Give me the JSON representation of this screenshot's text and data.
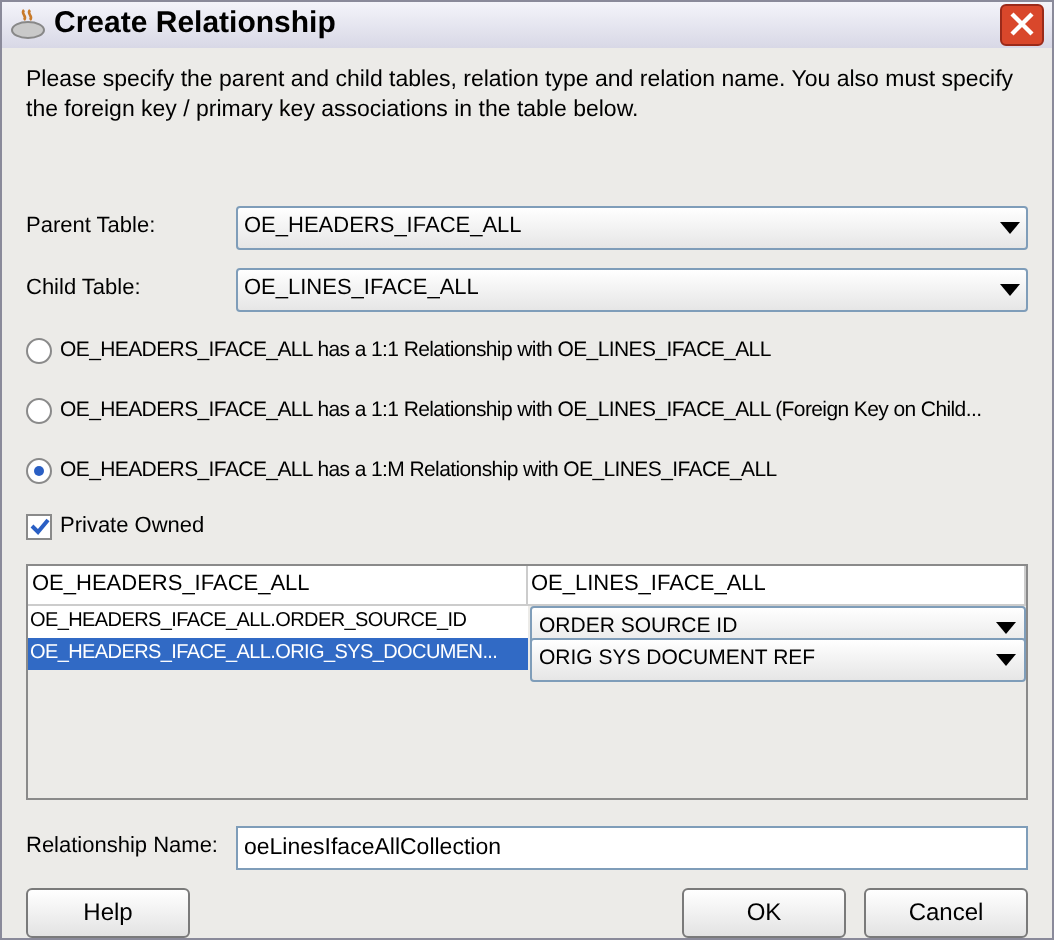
{
  "window": {
    "title": "Create Relationship"
  },
  "instructions": "Please specify the parent and child tables, relation type and relation name.  You also must specify the foreign key / primary key associations in the table below.",
  "parent_table": {
    "label": "Parent Table:",
    "value": "OE_HEADERS_IFACE_ALL"
  },
  "child_table": {
    "label": "Child Table:",
    "value": "OE_LINES_IFACE_ALL"
  },
  "relationship_types": [
    {
      "label": "OE_HEADERS_IFACE_ALL has a 1:1 Relationship with OE_LINES_IFACE_ALL",
      "selected": false
    },
    {
      "label": "OE_HEADERS_IFACE_ALL has a 1:1 Relationship with OE_LINES_IFACE_ALL (Foreign Key on Child...",
      "selected": false
    },
    {
      "label": "OE_HEADERS_IFACE_ALL has a 1:M Relationship with OE_LINES_IFACE_ALL",
      "selected": true
    }
  ],
  "private_owned": {
    "label": "Private Owned",
    "checked": true
  },
  "table": {
    "columns": [
      "OE_HEADERS_IFACE_ALL",
      "OE_LINES_IFACE_ALL"
    ],
    "rows": [
      {
        "source": "OE_HEADERS_IFACE_ALL.ORDER_SOURCE_ID",
        "destination": "ORDER SOURCE ID",
        "selected": false
      },
      {
        "source": "OE_HEADERS_IFACE_ALL.ORIG_SYS_DOCUMEN...",
        "destination": "ORIG SYS DOCUMENT REF",
        "selected": true
      }
    ]
  },
  "relationship_name": {
    "label": "Relationship Name:",
    "value": "oeLinesIfaceAllCollection"
  },
  "buttons": {
    "help": "Help",
    "ok": "OK",
    "cancel": "Cancel"
  }
}
